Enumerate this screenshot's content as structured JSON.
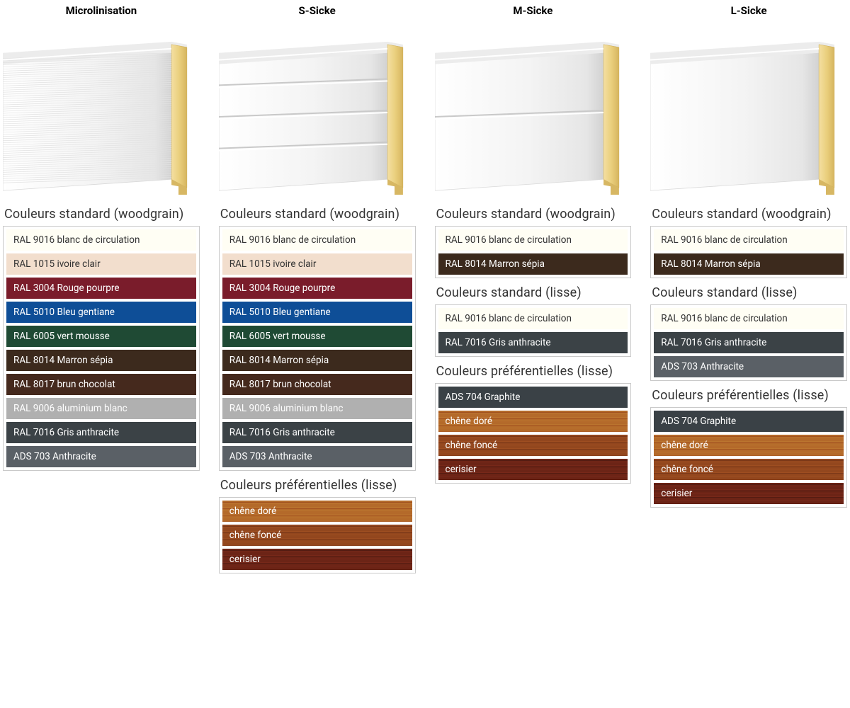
{
  "columns": [
    {
      "title": "Microlinisation",
      "panel": "micro",
      "sections": [
        {
          "heading": "Couleurs standard (woodgrain)",
          "items": [
            {
              "label": "RAL 9016 blanc de circulation",
              "bg": "#fffef4",
              "tone": "light"
            },
            {
              "label": "RAL 1015 ivoire clair",
              "bg": "#f2decd",
              "tone": "light"
            },
            {
              "label": "RAL 3004 Rouge pourpre",
              "bg": "#7a1c2b",
              "tone": "dark"
            },
            {
              "label": "RAL 5010 Bleu gentiane",
              "bg": "#0e4e97",
              "tone": "dark"
            },
            {
              "label": "RAL 6005 vert mousse",
              "bg": "#1f4a34",
              "tone": "dark"
            },
            {
              "label": "RAL 8014 Marron sépia",
              "bg": "#3c2a1d",
              "tone": "dark"
            },
            {
              "label": "RAL 8017 brun chocolat",
              "bg": "#45291d",
              "tone": "dark"
            },
            {
              "label": "RAL 9006 aluminium blanc",
              "bg": "#b0b0b0",
              "tone": "dark"
            },
            {
              "label": "RAL 7016 Gris anthracite",
              "bg": "#3b4246",
              "tone": "dark"
            },
            {
              "label": "ADS 703 Anthracite",
              "bg": "#5a6066",
              "tone": "dark"
            }
          ]
        }
      ]
    },
    {
      "title": "S-Sicke",
      "panel": "s",
      "sections": [
        {
          "heading": "Couleurs standard (woodgrain)",
          "items": [
            {
              "label": "RAL 9016 blanc de circulation",
              "bg": "#fffef4",
              "tone": "light"
            },
            {
              "label": "RAL 1015 ivoire clair",
              "bg": "#f2decd",
              "tone": "light"
            },
            {
              "label": "RAL 3004 Rouge pourpre",
              "bg": "#7a1c2b",
              "tone": "dark"
            },
            {
              "label": "RAL 5010 Bleu gentiane",
              "bg": "#0e4e97",
              "tone": "dark"
            },
            {
              "label": "RAL 6005 vert mousse",
              "bg": "#1f4a34",
              "tone": "dark"
            },
            {
              "label": "RAL 8014 Marron sépia",
              "bg": "#3c2a1d",
              "tone": "dark"
            },
            {
              "label": "RAL 8017 brun chocolat",
              "bg": "#45291d",
              "tone": "dark"
            },
            {
              "label": "RAL 9006 aluminium blanc",
              "bg": "#b0b0b0",
              "tone": "dark"
            },
            {
              "label": "RAL 7016 Gris anthracite",
              "bg": "#3b4246",
              "tone": "dark"
            },
            {
              "label": "ADS 703 Anthracite",
              "bg": "#5a6066",
              "tone": "dark"
            }
          ]
        },
        {
          "heading": "Couleurs préférentielles (lisse)",
          "items": [
            {
              "label": "chêne doré",
              "bg": "#b46a2a",
              "tone": "dark",
              "wood": true
            },
            {
              "label": "chêne foncé",
              "bg": "#93471e",
              "tone": "dark",
              "wood": true
            },
            {
              "label": "cerisier",
              "bg": "#6c2416",
              "tone": "dark",
              "wood": true
            }
          ]
        }
      ]
    },
    {
      "title": "M-Sicke",
      "panel": "m",
      "sections": [
        {
          "heading": "Couleurs standard (woodgrain)",
          "items": [
            {
              "label": "RAL 9016 blanc de circulation",
              "bg": "#fffef4",
              "tone": "light"
            },
            {
              "label": "RAL 8014 Marron sépia",
              "bg": "#3c2a1d",
              "tone": "dark"
            }
          ]
        },
        {
          "heading": "Couleurs standard (lisse)",
          "items": [
            {
              "label": "RAL 9016 blanc de circulation",
              "bg": "#fffef4",
              "tone": "light"
            },
            {
              "label": "RAL 7016 Gris anthracite",
              "bg": "#3b4246",
              "tone": "dark"
            }
          ]
        },
        {
          "heading": "Couleurs préférentielles (lisse)",
          "items": [
            {
              "label": "ADS 704 Graphite",
              "bg": "#3a4146",
              "tone": "dark"
            },
            {
              "label": "chêne doré",
              "bg": "#b46a2a",
              "tone": "dark",
              "wood": true
            },
            {
              "label": "chêne foncé",
              "bg": "#93471e",
              "tone": "dark",
              "wood": true
            },
            {
              "label": "cerisier",
              "bg": "#6c2416",
              "tone": "dark",
              "wood": true
            }
          ]
        }
      ]
    },
    {
      "title": "L-Sicke",
      "panel": "l",
      "sections": [
        {
          "heading": "Couleurs standard (woodgrain)",
          "items": [
            {
              "label": "RAL 9016 blanc de circulation",
              "bg": "#fffef4",
              "tone": "light"
            },
            {
              "label": "RAL 8014 Marron sépia",
              "bg": "#3c2a1d",
              "tone": "dark"
            }
          ]
        },
        {
          "heading": "Couleurs standard (lisse)",
          "items": [
            {
              "label": "RAL 9016 blanc de circulation",
              "bg": "#fffef4",
              "tone": "light"
            },
            {
              "label": "RAL 7016 Gris anthracite",
              "bg": "#3b4246",
              "tone": "dark"
            },
            {
              "label": "ADS 703 Anthracite",
              "bg": "#5a6066",
              "tone": "dark"
            }
          ]
        },
        {
          "heading": "Couleurs préférentielles (lisse)",
          "items": [
            {
              "label": "ADS 704 Graphite",
              "bg": "#3a4146",
              "tone": "dark"
            },
            {
              "label": "chêne doré",
              "bg": "#b46a2a",
              "tone": "dark",
              "wood": true
            },
            {
              "label": "chêne foncé",
              "bg": "#93471e",
              "tone": "dark",
              "wood": true
            },
            {
              "label": "cerisier",
              "bg": "#6c2416",
              "tone": "dark",
              "wood": true
            }
          ]
        }
      ]
    }
  ]
}
